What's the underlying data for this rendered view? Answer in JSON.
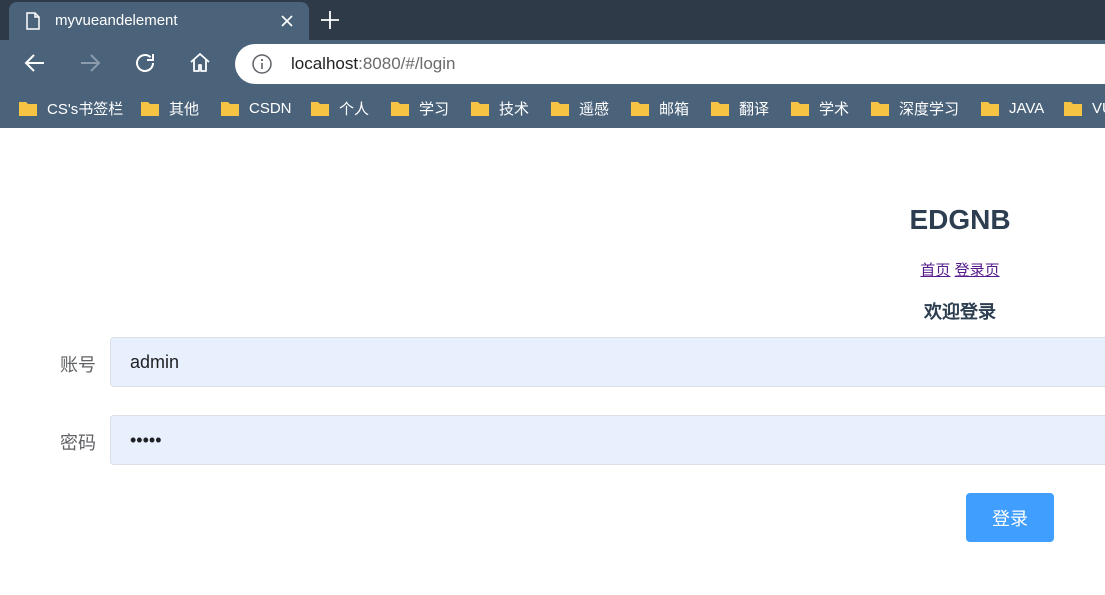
{
  "browser": {
    "tab_title": "myvueandelement",
    "url_host": "localhost",
    "url_rest": ":8080/#/login",
    "bookmarks": [
      "CS's书签栏",
      "其他",
      "CSDN",
      "个人",
      "学习",
      "技术",
      "遥感",
      "邮箱",
      "翻译",
      "学术",
      "深度学习",
      "JAVA",
      "VUE"
    ]
  },
  "page": {
    "title": "EDGNB",
    "nav_home": "首页",
    "nav_login": "登录页",
    "welcome": "欢迎登录",
    "account_label": "账号",
    "account_value": "admin",
    "password_label": "密码",
    "password_value": "•••••",
    "login_button": "登录"
  },
  "colors": {
    "chrome_dark": "#2e3a48",
    "chrome": "#4b637a",
    "folder": "#f6c342",
    "primary_button": "#409eff",
    "autofill_input": "#e8f0fe",
    "heading": "#2c3e50"
  }
}
